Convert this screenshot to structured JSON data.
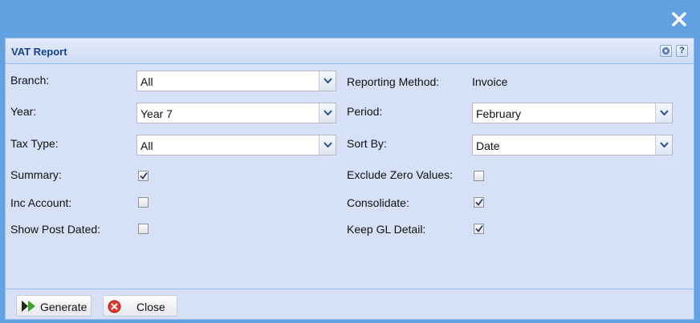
{
  "window": {
    "close_icon": "close-icon"
  },
  "panel": {
    "title": "VAT Report",
    "tools": {
      "settings_icon": "gear-icon",
      "help_label": "?"
    }
  },
  "form": {
    "branch": {
      "label": "Branch:",
      "value": "All"
    },
    "year": {
      "label": "Year:",
      "value": "Year 7"
    },
    "tax_type": {
      "label": "Tax Type:",
      "value": "All"
    },
    "summary": {
      "label": "Summary:",
      "checked": true
    },
    "inc_account": {
      "label": "Inc Account:",
      "checked": false
    },
    "show_post_dated": {
      "label": "Show Post Dated:",
      "checked": false
    },
    "reporting_method": {
      "label": "Reporting Method:",
      "value": "Invoice"
    },
    "period": {
      "label": "Period:",
      "value": "February"
    },
    "sort_by": {
      "label": "Sort By:",
      "value": "Date"
    },
    "exclude_zero": {
      "label": "Exclude Zero Values:",
      "checked": false
    },
    "consolidate": {
      "label": "Consolidate:",
      "checked": true
    },
    "keep_gl_detail": {
      "label": "Keep GL Detail:",
      "checked": true
    }
  },
  "toolbar": {
    "generate_label": "Generate",
    "close_label": "Close"
  }
}
